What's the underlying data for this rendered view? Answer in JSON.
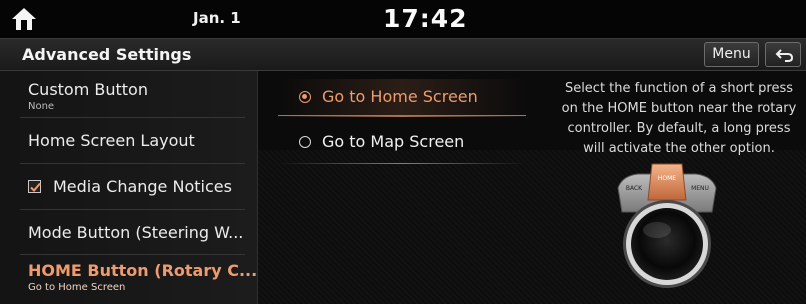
{
  "status_bar": {
    "date": "Jan. 1",
    "time": "17:42"
  },
  "header": {
    "title": "Advanced Settings",
    "menu_label": "Menu"
  },
  "sidebar": {
    "items": [
      {
        "label": "Custom Button",
        "sub": "None"
      },
      {
        "label": "Home Screen Layout"
      },
      {
        "label": "Media Change Notices",
        "checked": true
      },
      {
        "label": "Mode Button (Steering W..."
      },
      {
        "label": "HOME Button (Rotary C...",
        "sub": "Go to Home Screen",
        "active": true
      }
    ]
  },
  "options": [
    {
      "label": "Go to Home Screen",
      "selected": true
    },
    {
      "label": "Go to Map Screen",
      "selected": false
    }
  ],
  "help_text": "Select the function of a short press on the HOME button near the rotary controller. By default, a long press will activate the other option.",
  "controller": {
    "left_label": "BACK",
    "center_label": "HOME",
    "right_label": "MENU"
  },
  "colors": {
    "accent": "#ee9b70",
    "background": "#0b0b0b"
  }
}
